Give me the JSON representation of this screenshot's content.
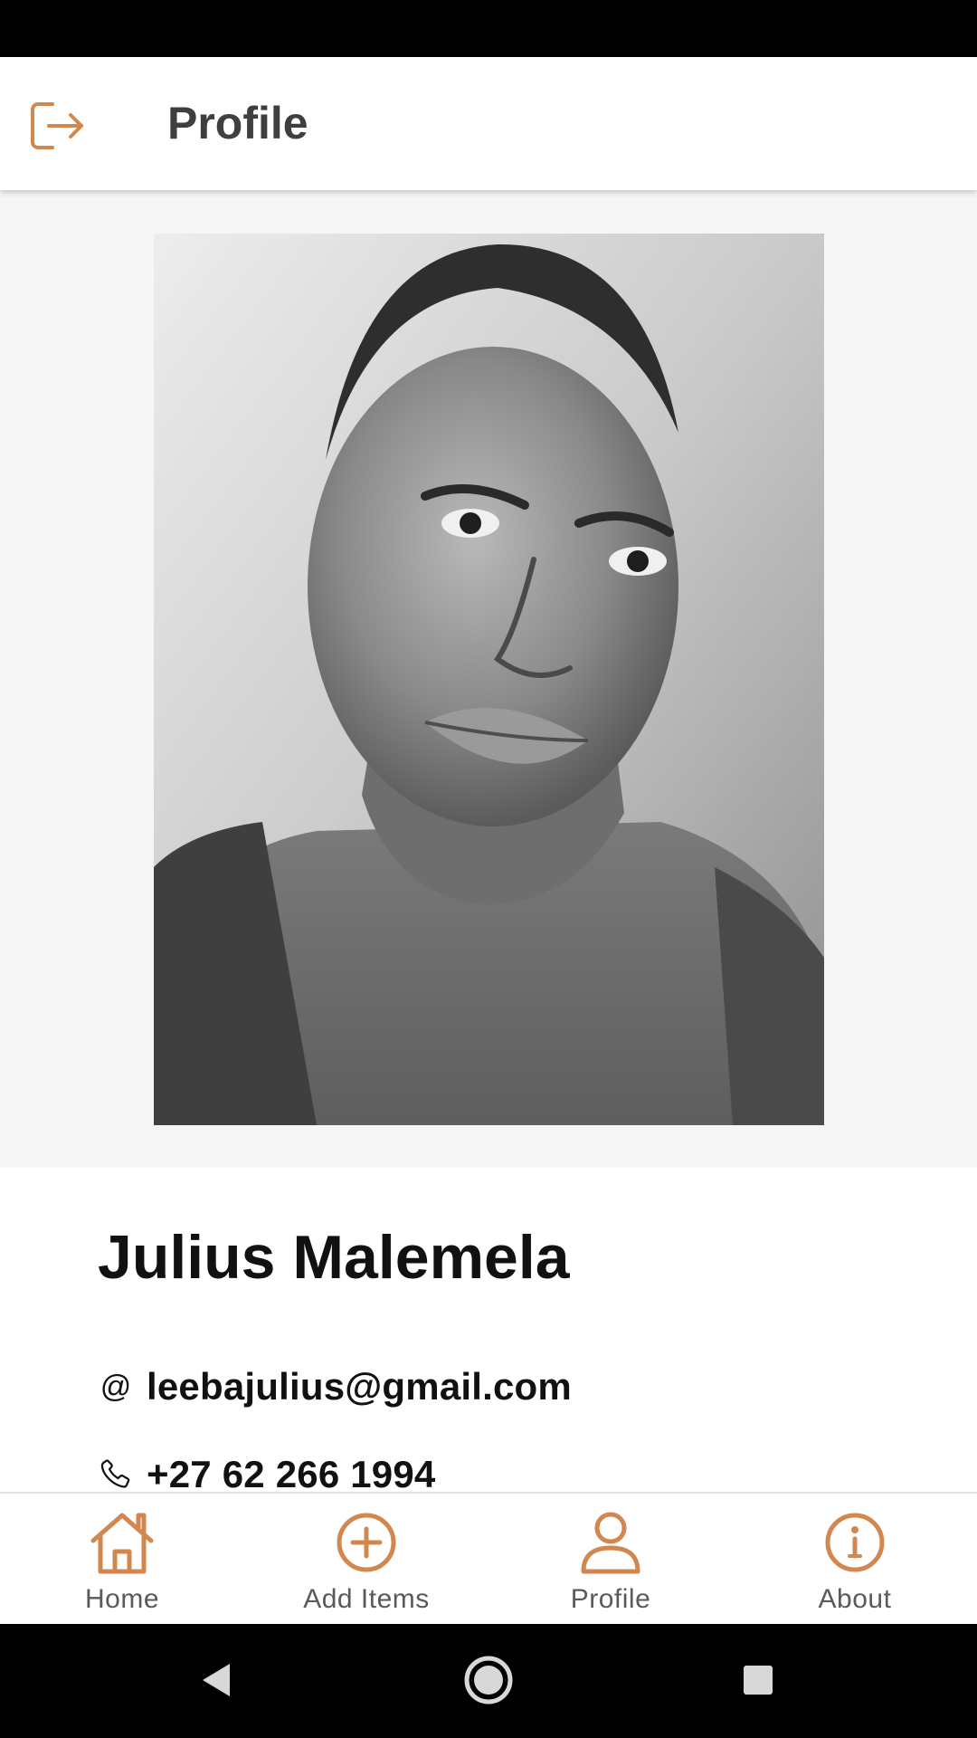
{
  "app_bar": {
    "title": "Profile",
    "logout_icon": "logout-icon"
  },
  "profile": {
    "photo_icon": "profile-photo",
    "name": "Julius Malemela",
    "email_icon": "at-icon",
    "email_symbol": "@",
    "email": "leebajulius@gmail.com",
    "phone_icon": "phone-icon",
    "phone": "+27 62 266 1994"
  },
  "bottom_nav": {
    "items": [
      {
        "label": "Home",
        "icon": "home-icon"
      },
      {
        "label": "Add Items",
        "icon": "add-circle-icon"
      },
      {
        "label": "Profile",
        "icon": "person-icon"
      },
      {
        "label": "About",
        "icon": "info-icon"
      }
    ]
  },
  "colors": {
    "accent": "#d2874e",
    "app_bar": "#ffffff",
    "background": "#f6f6f6"
  }
}
